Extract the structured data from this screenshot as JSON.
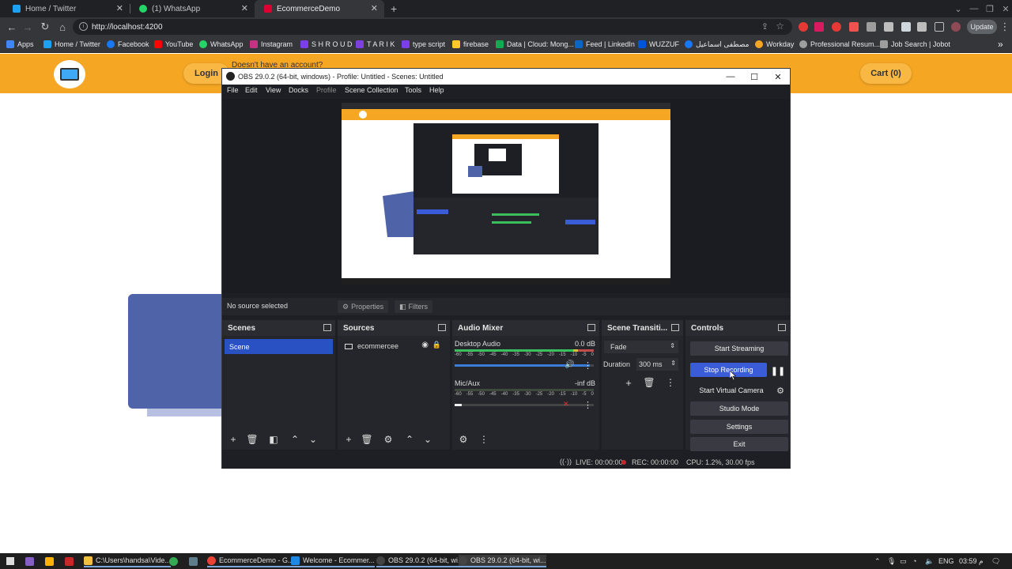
{
  "browser": {
    "tabs": [
      {
        "label": "Home / Twitter",
        "color": "#1da1f2",
        "active": false
      },
      {
        "label": "(1) WhatsApp",
        "color": "#25d366",
        "active": false
      },
      {
        "label": "EcommerceDemo",
        "color": "#dd0031",
        "active": true
      }
    ],
    "new_tab": "+",
    "url": "http://localhost:4200",
    "update_label": "Update",
    "bookmarks": [
      {
        "label": "Apps",
        "color": "#4285f4"
      },
      {
        "label": "Home / Twitter",
        "color": "#1da1f2"
      },
      {
        "label": "Facebook",
        "color": "#1877f2"
      },
      {
        "label": "YouTube",
        "color": "#ff0000"
      },
      {
        "label": "WhatsApp",
        "color": "#25d366"
      },
      {
        "label": "Instagram",
        "color": "#c13584"
      },
      {
        "label": "S H R O U D",
        "color": "#7b3fe4"
      },
      {
        "label": "T A R I K",
        "color": "#7b3fe4"
      },
      {
        "label": "type script",
        "color": "#7b3fe4"
      },
      {
        "label": "firebase",
        "color": "#ffca28"
      },
      {
        "label": "Data | Cloud: Mong...",
        "color": "#13aa52"
      },
      {
        "label": "Feed | LinkedIn",
        "color": "#0a66c2"
      },
      {
        "label": "WUZZUF",
        "color": "#0055d9"
      },
      {
        "label": "مصطفى اسماعيل",
        "color": "#1877f2"
      },
      {
        "label": "Workday",
        "color": "#f5a623"
      },
      {
        "label": "Professional Resum...",
        "color": "#9e9e9e"
      },
      {
        "label": "Job Search | Jobot",
        "color": "#9e9e9e"
      }
    ]
  },
  "site": {
    "login_label": "Login",
    "no_account": "Doesn't have an account?",
    "cart_label": "Cart (0)",
    "accent": "#f5a623"
  },
  "obs": {
    "title": "OBS 29.0.2 (64-bit, windows) - Profile: Untitled - Scenes: Untitled",
    "menu": [
      "File",
      "Edit",
      "View",
      "Docks",
      "Profile",
      "Scene Collection",
      "Tools",
      "Help"
    ],
    "no_source": "No source selected",
    "properties_label": "Properties",
    "filters_label": "Filters",
    "scenes": {
      "title": "Scenes",
      "items": [
        "Scene"
      ]
    },
    "sources": {
      "title": "Sources",
      "items": [
        "ecommercee"
      ]
    },
    "mixer": {
      "title": "Audio Mixer",
      "channels": [
        {
          "name": "Desktop Audio",
          "level": "0.0 dB",
          "volume_fraction": 0.97
        },
        {
          "name": "Mic/Aux",
          "level": "-inf dB",
          "volume_fraction": 0.05
        }
      ],
      "scale": [
        "-60",
        "-55",
        "-50",
        "-45",
        "-40",
        "-35",
        "-30",
        "-25",
        "-20",
        "-15",
        "-10",
        "-5",
        "0"
      ]
    },
    "transitions": {
      "title": "Scene Transiti...",
      "selected": "Fade",
      "duration_label": "Duration",
      "duration_value": "300 ms"
    },
    "controls": {
      "title": "Controls",
      "start_streaming": "Start Streaming",
      "stop_recording": "Stop Recording",
      "start_virtual_camera": "Start Virtual Camera",
      "studio_mode": "Studio Mode",
      "settings": "Settings",
      "exit": "Exit",
      "recording_color": "#3b5cd8"
    },
    "status": {
      "live": "LIVE: 00:00:00",
      "rec": "REC: 00:00:00",
      "cpu": "CPU: 1.2%, 30.00 fps"
    }
  },
  "taskbar": {
    "items": [
      {
        "label": "C:\\Users\\handsa\\Vide...",
        "color": "#f0c040"
      },
      {
        "label": "EcommerceDemo - G...",
        "color": "#ea4335"
      },
      {
        "label": "Welcome - Ecommer...",
        "color": "#1e88e5"
      },
      {
        "label": "OBS 29.0.2 (64-bit, wi...",
        "color": "#444"
      },
      {
        "label": "OBS 29.0.2 (64-bit, wi...",
        "color": "#444"
      }
    ],
    "lang": "ENG",
    "time": "03:59 م"
  }
}
